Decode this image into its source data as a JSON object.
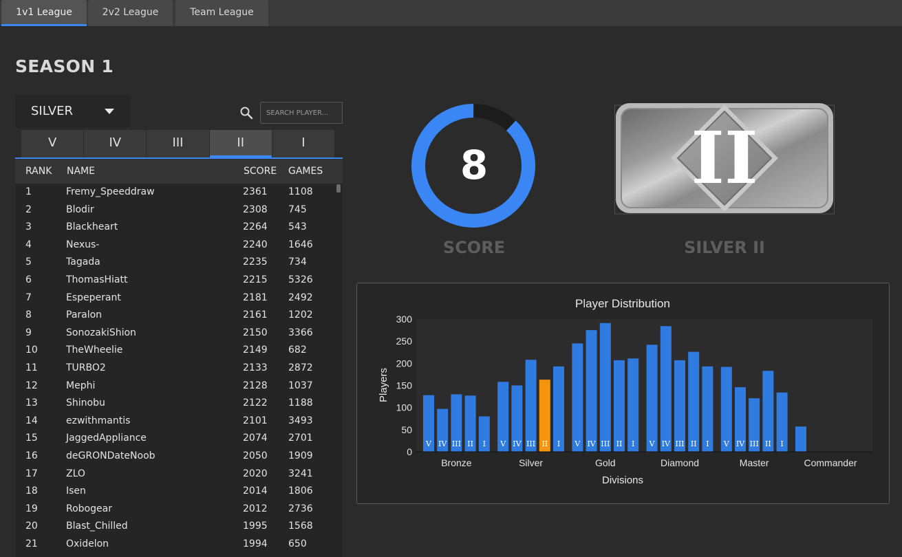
{
  "tabs": [
    "1v1 League",
    "2v2 League",
    "Team League"
  ],
  "active_tab": 0,
  "season_title": "SEASON 1",
  "division_select": {
    "value": "SILVER"
  },
  "search": {
    "placeholder": "SEARCH PLAYER..."
  },
  "tiers": [
    "V",
    "IV",
    "III",
    "II",
    "I"
  ],
  "active_tier": 3,
  "table": {
    "headers": {
      "rank": "RANK",
      "name": "NAME",
      "score": "SCORE",
      "games": "GAMES"
    },
    "rows": [
      [
        "1",
        "Fremy_Speeddraw",
        "2361",
        "1108"
      ],
      [
        "2",
        "Blodir",
        "2308",
        "745"
      ],
      [
        "3",
        "Blackheart",
        "2264",
        "543"
      ],
      [
        "4",
        "Nexus-",
        "2240",
        "1646"
      ],
      [
        "5",
        "Tagada",
        "2235",
        "734"
      ],
      [
        "6",
        "ThomasHiatt",
        "2215",
        "5326"
      ],
      [
        "7",
        "Espeperant",
        "2181",
        "2492"
      ],
      [
        "8",
        "Paralon",
        "2161",
        "1202"
      ],
      [
        "9",
        "SonozakiShion",
        "2150",
        "3366"
      ],
      [
        "10",
        "TheWheelie",
        "2149",
        "682"
      ],
      [
        "11",
        "TURBO2",
        "2133",
        "2872"
      ],
      [
        "12",
        "Mephi",
        "2128",
        "1037"
      ],
      [
        "13",
        "Shinobu",
        "2122",
        "1188"
      ],
      [
        "14",
        "ezwithmantis",
        "2101",
        "3493"
      ],
      [
        "15",
        "JaggedAppliance",
        "2074",
        "2701"
      ],
      [
        "16",
        "deGRONDateNoob",
        "2050",
        "1909"
      ],
      [
        "17",
        "ZLO",
        "2020",
        "3241"
      ],
      [
        "18",
        "Isen",
        "2014",
        "1806"
      ],
      [
        "19",
        "Robogear",
        "2012",
        "2736"
      ],
      [
        "20",
        "Blast_Chilled",
        "1995",
        "1568"
      ],
      [
        "21",
        "Oxidelon",
        "1994",
        "650"
      ]
    ]
  },
  "score": {
    "value": "8",
    "label": "SCORE",
    "ring_fraction": 0.88
  },
  "rank_badge": {
    "tier_numeral": "II",
    "label": "SILVER II"
  },
  "colors": {
    "accent": "#3a86f5",
    "bar": "#2f7be0",
    "highlight": "#f5950e"
  },
  "chart_data": {
    "type": "bar",
    "title": "Player Distribution",
    "xlabel": "Divisions",
    "ylabel": "Players",
    "ylim": [
      0,
      300
    ],
    "yticks": [
      0,
      50,
      100,
      150,
      200,
      250,
      300
    ],
    "groups": [
      {
        "name": "Bronze",
        "tiers": [
          "V",
          "IV",
          "III",
          "II",
          "I"
        ],
        "values": [
          128,
          97,
          130,
          127,
          80
        ]
      },
      {
        "name": "Silver",
        "tiers": [
          "V",
          "IV",
          "III",
          "II",
          "I"
        ],
        "values": [
          158,
          150,
          208,
          163,
          193
        ]
      },
      {
        "name": "Gold",
        "tiers": [
          "V",
          "IV",
          "III",
          "II",
          "I"
        ],
        "values": [
          245,
          275,
          291,
          207,
          211
        ]
      },
      {
        "name": "Diamond",
        "tiers": [
          "V",
          "IV",
          "III",
          "II",
          "I"
        ],
        "values": [
          242,
          284,
          207,
          226,
          193
        ]
      },
      {
        "name": "Master",
        "tiers": [
          "V",
          "IV",
          "III",
          "II",
          "I"
        ],
        "values": [
          192,
          146,
          121,
          183,
          134
        ]
      },
      {
        "name": "Commander",
        "tiers": [
          ""
        ],
        "values": [
          57
        ]
      }
    ],
    "highlight": {
      "group": 1,
      "tier": 3
    },
    "grid": false,
    "legend": "none"
  }
}
